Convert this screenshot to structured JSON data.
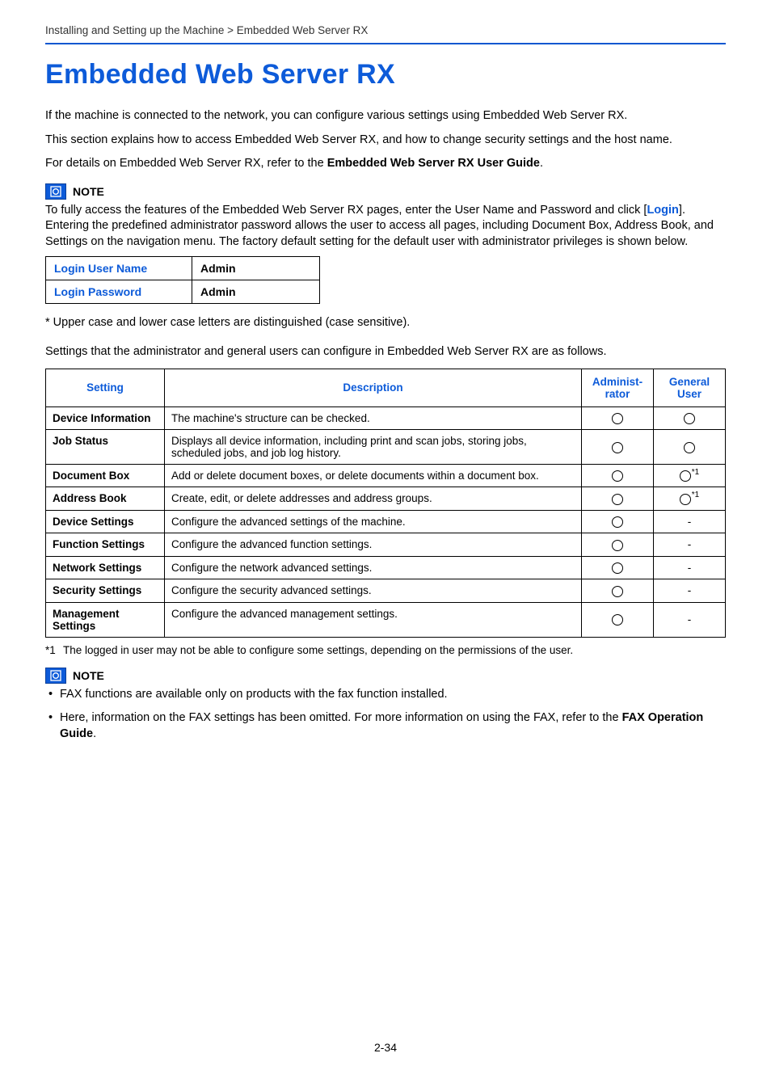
{
  "breadcrumb": "Installing and Setting up the Machine > Embedded Web Server RX",
  "title": "Embedded Web Server RX",
  "intro": {
    "p1": "If the machine is connected to the network, you can configure various settings using Embedded Web Server RX.",
    "p2": "This section explains how to access Embedded Web Server RX, and how to change security settings and the host name.",
    "p3_prefix": "For details on Embedded Web Server RX, refer to the ",
    "p3_bold": "Embedded Web Server RX User Guide",
    "p3_suffix": "."
  },
  "note1": {
    "label": "NOTE",
    "body_pre": "To fully access the features of the Embedded Web Server RX pages, enter the User Name and Password and click [",
    "login_text": "Login",
    "body_post": "]. Entering the predefined administrator password allows the user to access all pages, including Document Box, Address Book, and Settings on the navigation menu. The factory default setting for the default user with administrator privileges is shown below."
  },
  "login_table": {
    "rows": [
      {
        "label": "Login User Name",
        "value": "Admin"
      },
      {
        "label": "Login Password",
        "value": "Admin"
      }
    ]
  },
  "case_note": "* Upper case and lower case letters are distinguished (case sensitive).",
  "settings_intro": "Settings that the administrator and general users can configure in Embedded Web Server RX are as follows.",
  "settings_table": {
    "headers": {
      "setting": "Setting",
      "description": "Description",
      "admin": "Administ-rator",
      "general": "General User"
    },
    "rows": [
      {
        "setting": "Device Information",
        "description": "The machine's structure can be checked.",
        "admin": "circle",
        "general": "circle"
      },
      {
        "setting": "Job Status",
        "description": "Displays all device information, including print and scan jobs, storing jobs, scheduled jobs, and job log history.",
        "admin": "circle",
        "general": "circle"
      },
      {
        "setting": "Document Box",
        "description": "Add or delete document boxes, or delete documents within a document box.",
        "admin": "circle",
        "general": "circle_fn1"
      },
      {
        "setting": "Address Book",
        "description": "Create, edit, or delete addresses and address groups.",
        "admin": "circle",
        "general": "circle_fn1"
      },
      {
        "setting": "Device Settings",
        "description": "Configure the advanced settings of the machine.",
        "admin": "circle",
        "general": "dash"
      },
      {
        "setting": "Function Settings",
        "description": "Configure the advanced function settings.",
        "admin": "circle",
        "general": "dash"
      },
      {
        "setting": "Network Settings",
        "description": "Configure the network advanced settings.",
        "admin": "circle",
        "general": "dash"
      },
      {
        "setting": "Security Settings",
        "description": "Configure the security advanced settings.",
        "admin": "circle",
        "general": "dash"
      },
      {
        "setting": "Management Settings",
        "description": "Configure the advanced management settings.",
        "admin": "circle",
        "general": "dash"
      }
    ]
  },
  "footnote1": {
    "idx": "*1",
    "text": "The logged in user may not be able to configure some settings, depending on the permissions of the user."
  },
  "note2": {
    "label": "NOTE",
    "bullets": [
      {
        "text": "FAX functions are available only on products with the fax function installed."
      },
      {
        "pre": "Here, information on the FAX settings has been omitted. For more information on using the FAX, refer to the ",
        "bold": "FAX Operation Guide",
        "post": "."
      }
    ]
  },
  "page_number": "2-34"
}
